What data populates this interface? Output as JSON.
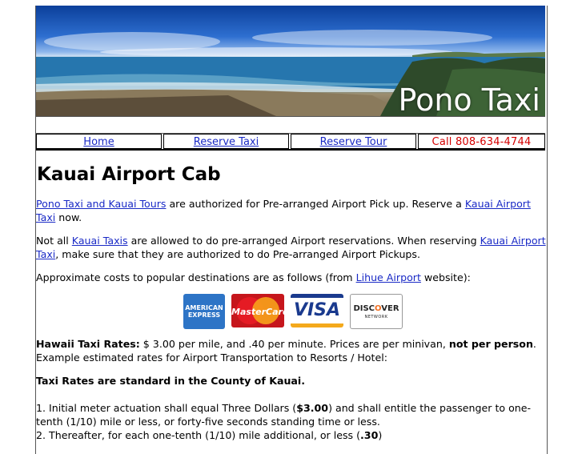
{
  "banner": {
    "title": "Pono Taxi"
  },
  "nav": {
    "home": "Home",
    "reserve_taxi": "Reserve Taxi",
    "reserve_tour": "Reserve Tour",
    "call": "Call 808-634-4744"
  },
  "main": {
    "heading": "Kauai Airport Cab",
    "p1": {
      "link1": "Pono Taxi and Kauai Tours",
      "text1": " are authorized for Pre-arranged Airport Pick up. Reserve a ",
      "link2": "Kauai Airport Taxi",
      "text2": " now."
    },
    "p2": {
      "text1": "Not all ",
      "link1": "Kauai Taxis",
      "text2": " are allowed to do pre-arranged Airport reservations. When reserving ",
      "link2": "Kauai Airport Taxi",
      "text3": ", make sure that they are authorized to do Pre-arranged Airport Pickups."
    },
    "p3": {
      "text1": "Approximate costs to popular destinations are as follows (from ",
      "link1": "Lihue Airport",
      "text2": " website):"
    },
    "cards": {
      "amex_line1": "AMERICAN",
      "amex_line2": "EXPRESS",
      "mastercard": "MasterCard",
      "visa": "VISA",
      "discover_a": "DISC",
      "discover_o": "O",
      "discover_b": "VER",
      "discover_sub": "NETWORK"
    },
    "p4": {
      "bold1": "Hawaii Taxi Rates:",
      "text1": " $ 3.00 per mile, and .40 per minute. Prices are per minivan, ",
      "bold2": "not per person",
      "text2": ". Example estimated rates for Airport Transportation to Resorts / Hotel:"
    },
    "p5": {
      "bold": "Taxi Rates are standard in the County of Kauai."
    },
    "p6": {
      "text1": "1. Initial meter actuation shall equal Three Dollars (",
      "bold": "$3.00",
      "text2": ") and shall entitle the passenger to one-tenth (1/10) mile or less, or forty-five seconds standing time or less."
    },
    "p7": {
      "text1": "2. Thereafter, for each one-tenth (1/10) mile additional, or less (",
      "bold": ".30",
      "text2": ")"
    }
  }
}
